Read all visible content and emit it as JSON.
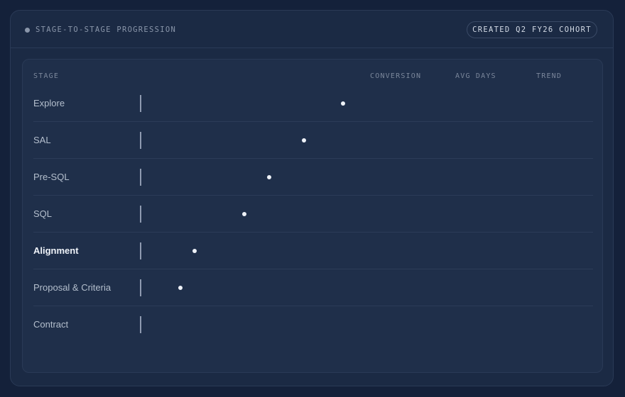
{
  "header": {
    "title": "STAGE-TO-STAGE PROGRESSION",
    "cohort": "CREATED Q2 FY26 COHORT"
  },
  "columns": {
    "stage": "STAGE",
    "conversion": "CONVERSION",
    "avg_days": "AVG DAYS",
    "trend": "TREND"
  },
  "colors": {
    "background": "#14213a",
    "card": "#1b2a44",
    "panel": "#1f2f4a",
    "dot": "#eef2f8",
    "baseline": "#8e9ab0"
  },
  "chart_data": {
    "type": "scatter",
    "title": "STAGE-TO-STAGE PROGRESSION",
    "subtitle": "CREATED Q2 FY26 COHORT",
    "categories": [
      "Explore",
      "SAL",
      "Pre-SQL",
      "SQL",
      "Alignment",
      "Proposal & Criteria",
      "Contract"
    ],
    "highlighted": "Alignment",
    "values": [
      100,
      81,
      64,
      52,
      28,
      21,
      null
    ],
    "xlim": [
      0,
      100
    ],
    "grid": false,
    "legend": "none"
  }
}
